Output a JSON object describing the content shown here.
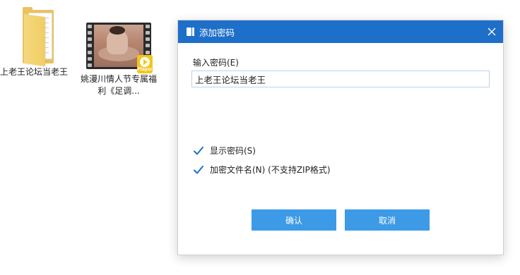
{
  "desktop": {
    "icons": [
      {
        "label": "上老王论坛当老王",
        "icon": "folder-icon"
      },
      {
        "label": "姚漫川情人节专属福利《足调...",
        "icon": "video-file-icon",
        "badge": "Player"
      }
    ]
  },
  "dialog": {
    "title": "添加密码",
    "icon": "archive-icon",
    "close_icon": "close-icon",
    "password_label": "输入密码(E)",
    "password_value": "上老王论坛当老王",
    "show_password": {
      "label": "显示密码(S)",
      "checked": true
    },
    "encrypt_filenames": {
      "label": "加密文件名(N) (不支持ZIP格式)",
      "checked": true
    },
    "ok_label": "确认",
    "cancel_label": "取消"
  },
  "colors": {
    "titlebar": "#1e6fc9",
    "button": "#3d9ae6",
    "checkmark": "#1e6fc9"
  }
}
